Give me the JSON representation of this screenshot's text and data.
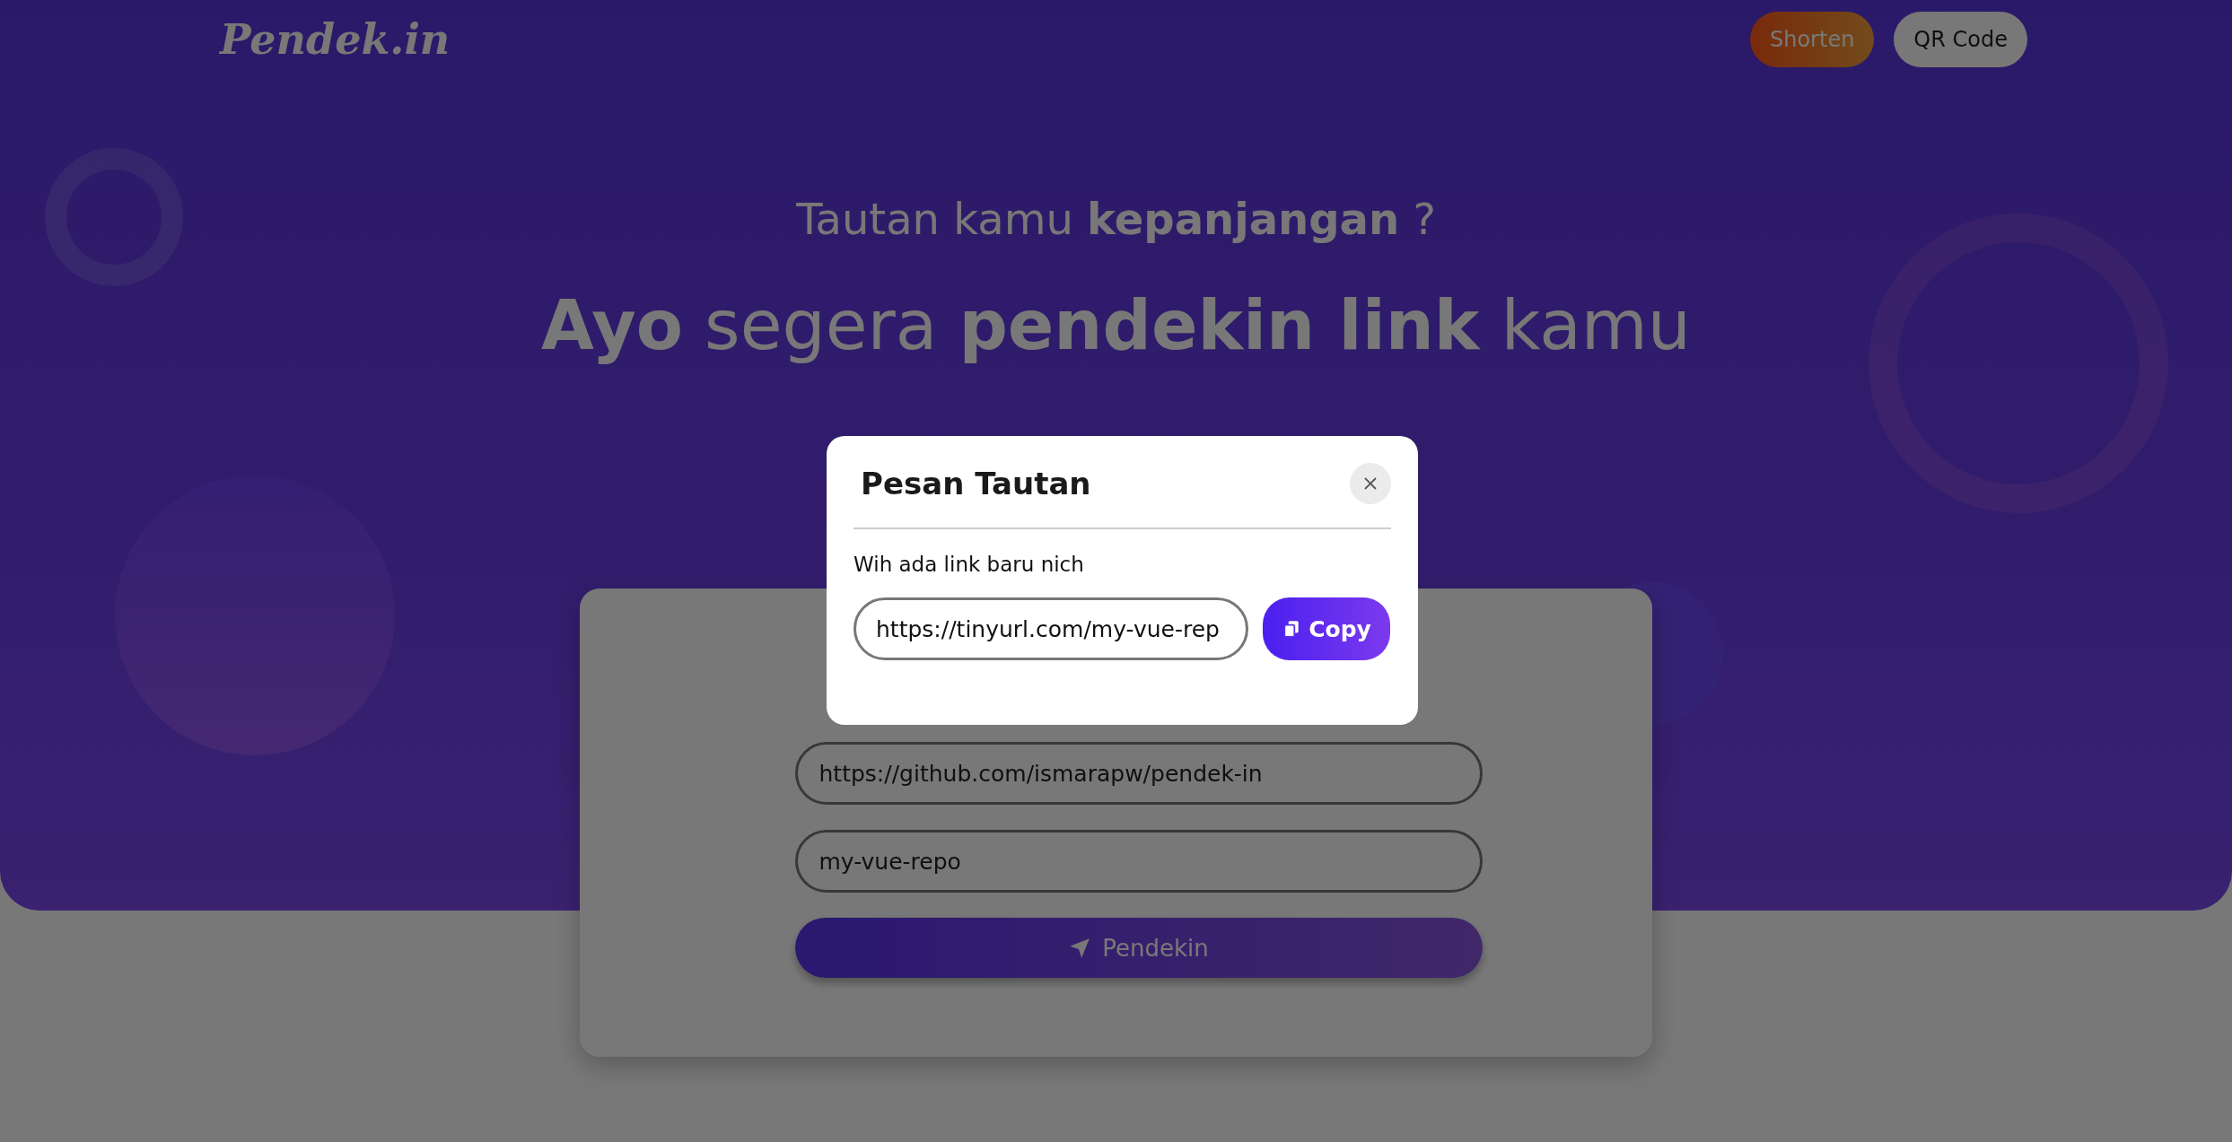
{
  "brand": "Pendek.in",
  "nav": [
    {
      "label": "Shorten",
      "kind": "primary"
    },
    {
      "label": "QR Code",
      "kind": "secondary"
    }
  ],
  "hero": {
    "subtitle": "Tautan kamu **kepanjangan** ?",
    "headline_lines": [
      "**Ayo** segera **pendekin link** kamu"
    ]
  },
  "form": {
    "fields": [
      {
        "value": "https://github.com/ismarapw/pendek-in"
      },
      {
        "value": "my-vue-repo"
      }
    ],
    "submit": "Pendekin"
  },
  "modal": {
    "title": "Pesan Tautan",
    "message": "Wih ada link baru nich",
    "link": "https://tinyurl.com/my-vue-rep",
    "copy_label": "Copy"
  }
}
